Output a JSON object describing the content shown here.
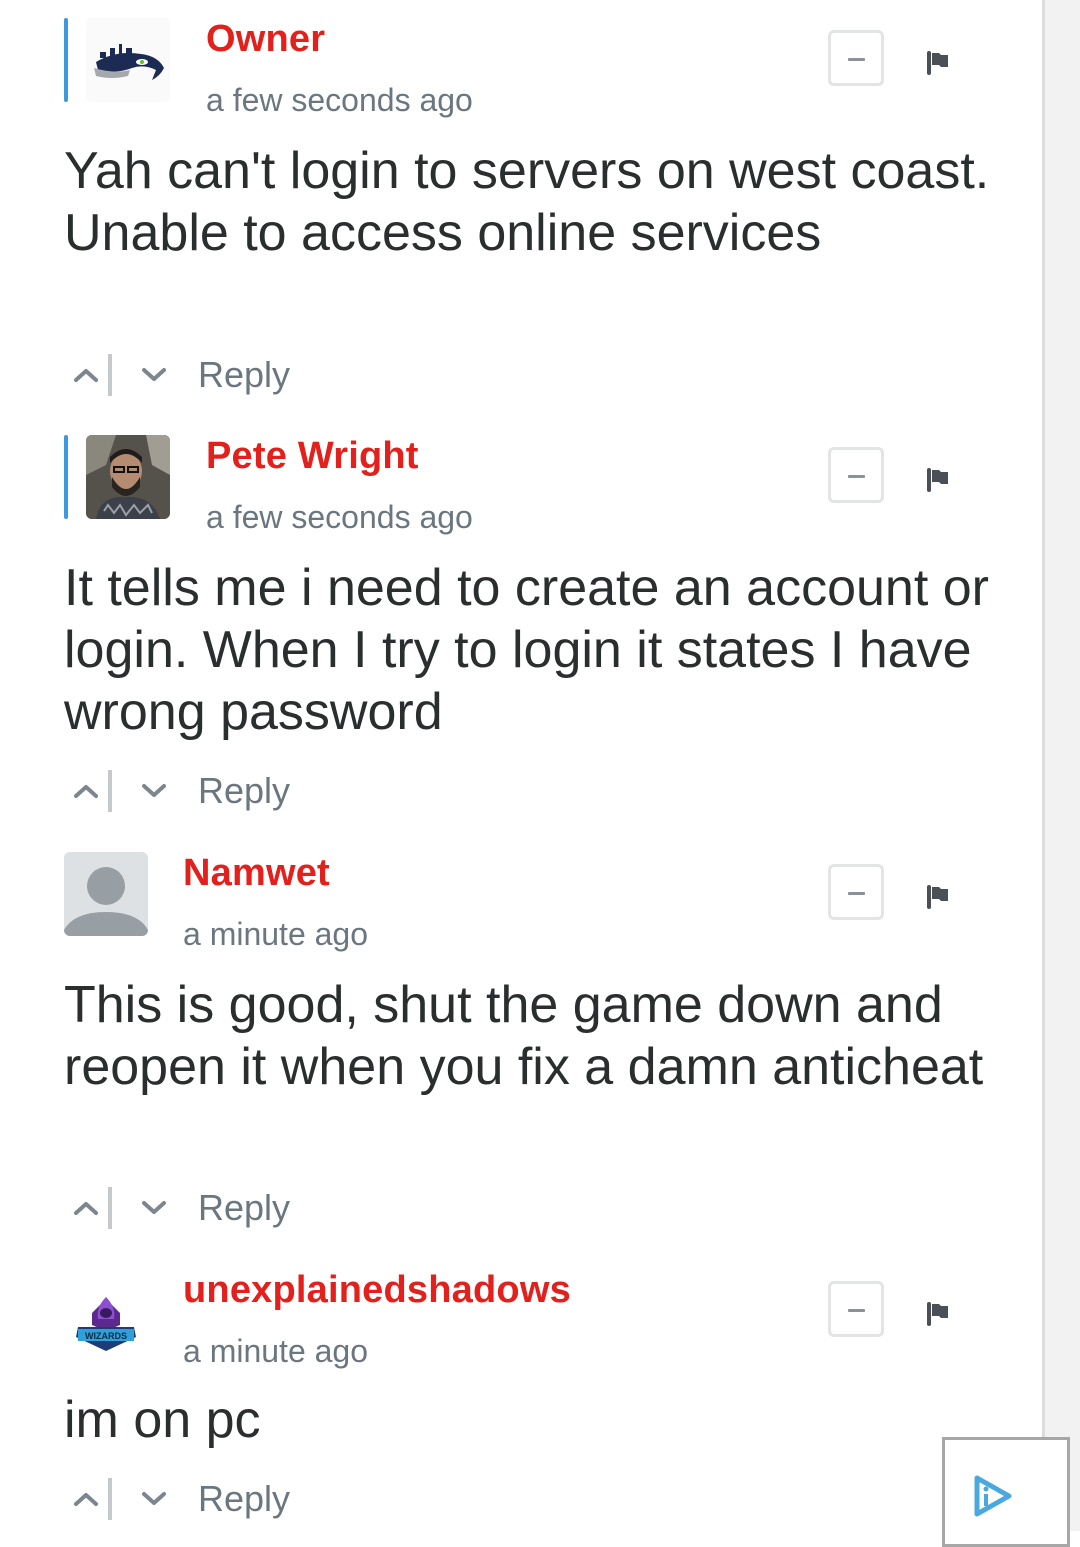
{
  "comments": [
    {
      "author": "Owner",
      "time": "a few seconds ago",
      "avatar": "seahawks-logo",
      "text": "Yah can't login to servers on west coast. Unable to access online services",
      "reply_label": "Reply",
      "highlighted": true
    },
    {
      "author": "Pete Wright",
      "time": "a few seconds ago",
      "avatar": "user-photo",
      "text": "It tells me i need to create an account or login. When I try to login it states I have wrong password",
      "reply_label": "Reply",
      "highlighted": true
    },
    {
      "author": "Namwet",
      "time": "a minute ago",
      "avatar": "default-avatar",
      "text": "This is good, shut the game down and reopen it when you fix a damn anticheat",
      "reply_label": "Reply",
      "highlighted": false
    },
    {
      "author": "unexplainedshadows",
      "time": "a minute ago",
      "avatar": "wizards-logo",
      "avatar_text": "WIZARDS",
      "text": "im on pc",
      "reply_label": "Reply",
      "highlighted": false
    }
  ],
  "colors": {
    "author": "#e3201b",
    "highlight_bar": "#3d98e0",
    "meta": "#6b7780",
    "body": "#2a2e2e"
  },
  "ad": {
    "icon": "adchoices-icon"
  }
}
